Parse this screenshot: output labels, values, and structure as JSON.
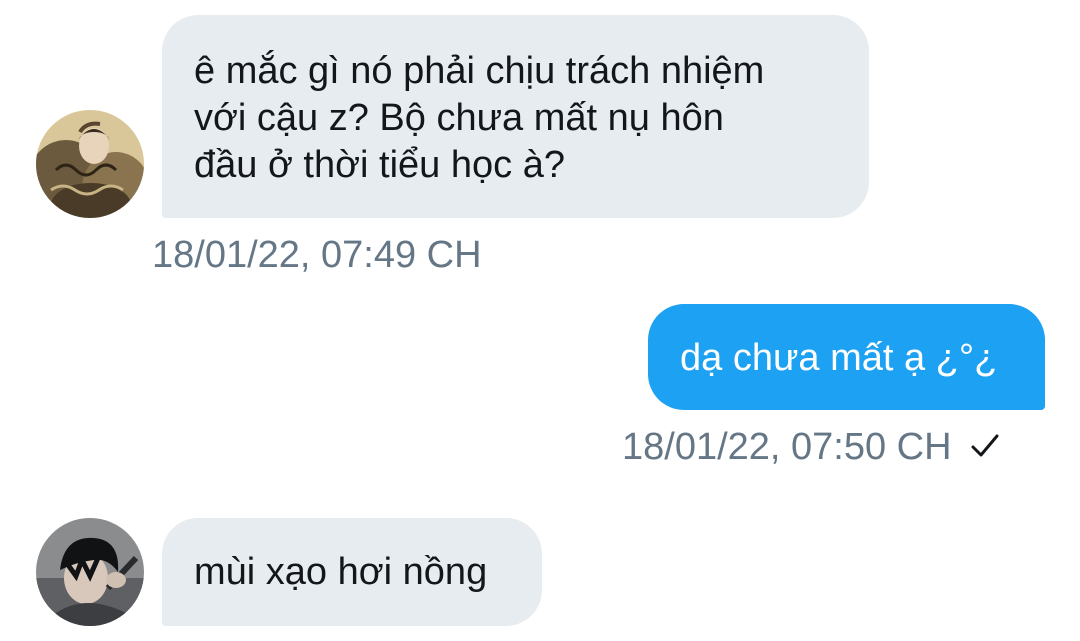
{
  "conversation": {
    "messages": [
      {
        "direction": "incoming",
        "avatar_icon": "contact-avatar-fur-coat",
        "text": "ê mắc gì nó phải chịu trách nhiệm\nvới cậu z? Bộ chưa mất nụ hôn\nđầu ở thời tiểu học à?",
        "timestamp": "18/01/22, 07:49 CH"
      },
      {
        "direction": "outgoing",
        "text": "dạ chưa mất ạ ¿°¿",
        "timestamp": "18/01/22, 07:50 CH",
        "status_icon": "sent-check-icon"
      },
      {
        "direction": "incoming",
        "avatar_icon": "contact-avatar-dark-hair",
        "text": "mùi xạo hơi nồng"
      }
    ]
  },
  "colors": {
    "incoming_bubble": "#e6ecf0",
    "outgoing_bubble": "#1da1f2",
    "timestamp_text": "#657786",
    "body_text": "#14171a"
  }
}
